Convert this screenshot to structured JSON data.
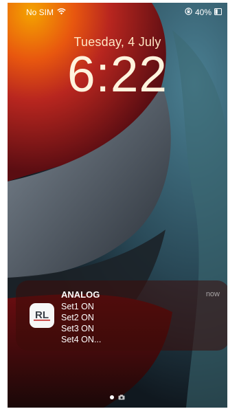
{
  "status_bar": {
    "carrier": "No SIM",
    "battery_percent": "40%",
    "battery_level": 0.4
  },
  "lock_screen": {
    "date": "Tuesday, 4 July",
    "time": "6:22"
  },
  "notification": {
    "app_name": "ANALOG",
    "time": "now",
    "app_icon_text": "RL",
    "lines": [
      "Set1 ON",
      "Set2 ON",
      "Set3 ON",
      "Set4 ON..."
    ]
  },
  "pager": {
    "icons": [
      "page-dot-icon",
      "camera-icon"
    ]
  },
  "icons": {
    "wifi": "wifi-icon",
    "rotation_lock": "rotation-lock-icon",
    "battery": "battery-icon"
  }
}
